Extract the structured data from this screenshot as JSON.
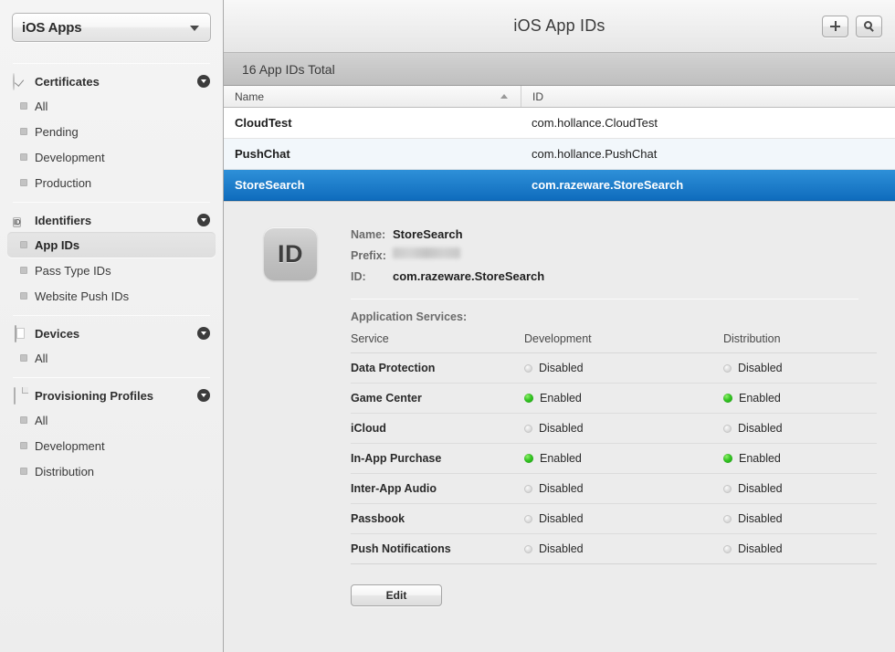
{
  "sidebar": {
    "team_selector": {
      "label": "iOS Apps",
      "icon": "chevron-down-icon"
    },
    "groups": [
      {
        "title": "Certificates",
        "icon": "certificate-icon",
        "disclosure_icon": "chevron-down-circle-icon",
        "items": [
          {
            "label": "All",
            "selected": false
          },
          {
            "label": "Pending",
            "selected": false
          },
          {
            "label": "Development",
            "selected": false
          },
          {
            "label": "Production",
            "selected": false
          }
        ]
      },
      {
        "title": "Identifiers",
        "icon": "id-icon",
        "disclosure_icon": "chevron-down-circle-icon",
        "items": [
          {
            "label": "App IDs",
            "selected": true
          },
          {
            "label": "Pass Type IDs",
            "selected": false
          },
          {
            "label": "Website Push IDs",
            "selected": false
          }
        ]
      },
      {
        "title": "Devices",
        "icon": "device-icon",
        "disclosure_icon": "chevron-down-circle-icon",
        "items": [
          {
            "label": "All",
            "selected": false
          }
        ]
      },
      {
        "title": "Provisioning Profiles",
        "icon": "document-icon",
        "disclosure_icon": "chevron-down-circle-icon",
        "items": [
          {
            "label": "All",
            "selected": false
          },
          {
            "label": "Development",
            "selected": false
          },
          {
            "label": "Distribution",
            "selected": false
          }
        ]
      }
    ]
  },
  "header": {
    "title": "iOS App IDs",
    "add_button": {
      "icon": "plus-icon",
      "label": ""
    },
    "search_button": {
      "icon": "search-icon",
      "label": ""
    }
  },
  "count_bar": {
    "text": "16 App IDs Total"
  },
  "table": {
    "columns": [
      {
        "label": "Name",
        "sort": "ascending",
        "sort_icon": "sort-ascending-icon"
      },
      {
        "label": "ID",
        "sort": "none"
      }
    ],
    "rows": [
      {
        "name": "CloudTest",
        "id": "com.hollance.CloudTest",
        "selected": false
      },
      {
        "name": "PushChat",
        "id": "com.hollance.PushChat",
        "selected": false
      },
      {
        "name": "StoreSearch",
        "id": "com.razeware.StoreSearch",
        "selected": true
      }
    ]
  },
  "detail": {
    "badge_text": "ID",
    "badge_icon": "app-id-badge-icon",
    "fields": [
      {
        "key": "Name:",
        "value": "StoreSearch",
        "redacted": false
      },
      {
        "key": "Prefix:",
        "value": "",
        "redacted": true
      },
      {
        "key": "ID:",
        "value": "com.razeware.StoreSearch",
        "redacted": false
      }
    ],
    "services_label": "Application Services:",
    "services_columns": [
      "Service",
      "Development",
      "Distribution"
    ],
    "services": [
      {
        "name": "Data Protection",
        "development": "Disabled",
        "development_state": "off",
        "distribution": "Disabled",
        "distribution_state": "off"
      },
      {
        "name": "Game Center",
        "development": "Enabled",
        "development_state": "on",
        "distribution": "Enabled",
        "distribution_state": "on"
      },
      {
        "name": "iCloud",
        "development": "Disabled",
        "development_state": "off",
        "distribution": "Disabled",
        "distribution_state": "off"
      },
      {
        "name": "In-App Purchase",
        "development": "Enabled",
        "development_state": "on",
        "distribution": "Enabled",
        "distribution_state": "on"
      },
      {
        "name": "Inter-App Audio",
        "development": "Disabled",
        "development_state": "off",
        "distribution": "Disabled",
        "distribution_state": "off"
      },
      {
        "name": "Passbook",
        "development": "Disabled",
        "development_state": "off",
        "distribution": "Disabled",
        "distribution_state": "off"
      },
      {
        "name": "Push Notifications",
        "development": "Disabled",
        "development_state": "off",
        "distribution": "Disabled",
        "distribution_state": "off"
      }
    ],
    "edit_button": "Edit"
  },
  "colors": {
    "selection_blue_top": "#2e90d8",
    "selection_blue_bottom": "#0f6cbd",
    "enabled_green": "#35c423",
    "disabled_gray": "#dedede",
    "sidebar_bg": "#ededed",
    "detail_bg": "#ececec"
  }
}
